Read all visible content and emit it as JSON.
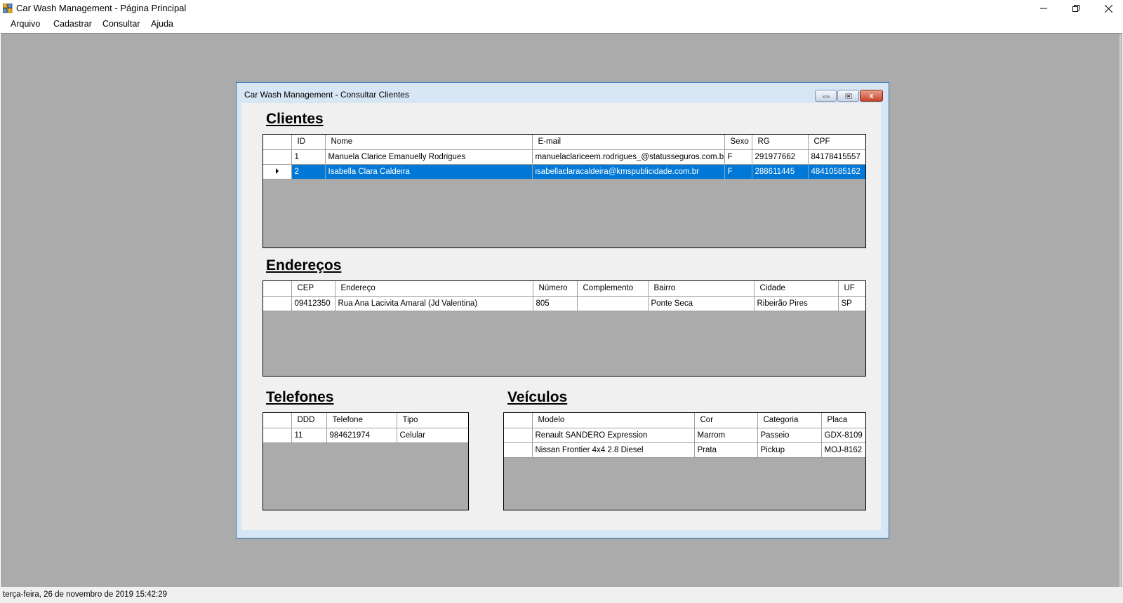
{
  "window": {
    "title": "Car Wash Management - Página Principal",
    "controls": {
      "minimize": "—",
      "maximize": "❐",
      "close": "✕"
    }
  },
  "menu": [
    {
      "label": "Arquivo"
    },
    {
      "label": "Cadastrar"
    },
    {
      "label": "Consultar"
    },
    {
      "label": "Ajuda"
    }
  ],
  "child_window": {
    "title": "Car Wash Management - Consultar Clientes",
    "close_glyph": "x"
  },
  "clientes": {
    "title": "Clientes",
    "columns": [
      "ID",
      "Nome",
      "E-mail",
      "Sexo",
      "RG",
      "CPF"
    ],
    "rows": [
      [
        "1",
        "Manuela Clarice Emanuelly Rodrigues",
        "manuelaclariceem.rodrigues_@statusseguros.com.br",
        "F",
        "291977662",
        "84178415557"
      ],
      [
        "2",
        "Isabella Clara Caldeira",
        "isabellaclaracaldeira@kmspublicidade.com.br",
        "F",
        "288611445",
        "48410585162"
      ]
    ],
    "selected_row": 1
  },
  "enderecos": {
    "title": "Endereços",
    "columns": [
      "CEP",
      "Endereço",
      "Número",
      "Complemento",
      "Bairro",
      "Cidade",
      "UF"
    ],
    "rows": [
      [
        "09412350",
        "Rua Ana Lacivita Amaral (Jd Valentina)",
        "805",
        "",
        "Ponte Seca",
        "Ribeirão Pires",
        "SP"
      ]
    ]
  },
  "telefones": {
    "title": "Telefones",
    "columns": [
      "DDD",
      "Telefone",
      "Tipo"
    ],
    "rows": [
      [
        "11",
        "984621974",
        "Celular"
      ]
    ]
  },
  "veiculos": {
    "title": "Veículos",
    "columns": [
      "Modelo",
      "Cor",
      "Categoria",
      "Placa"
    ],
    "rows": [
      [
        "Renault SANDERO Expression",
        "Marrom",
        "Passeio",
        "GDX-8109"
      ],
      [
        "Nissan Frontier 4x4 2.8 Diesel",
        "Prata",
        "Pickup",
        "MOJ-8162"
      ]
    ]
  },
  "status": {
    "datetime": "terça-feira, 26 de novembro de 2019  15:42:29"
  },
  "colors": {
    "selection": "#0078d7",
    "mdi_background": "#ababab",
    "child_border": "#2f6fae"
  }
}
